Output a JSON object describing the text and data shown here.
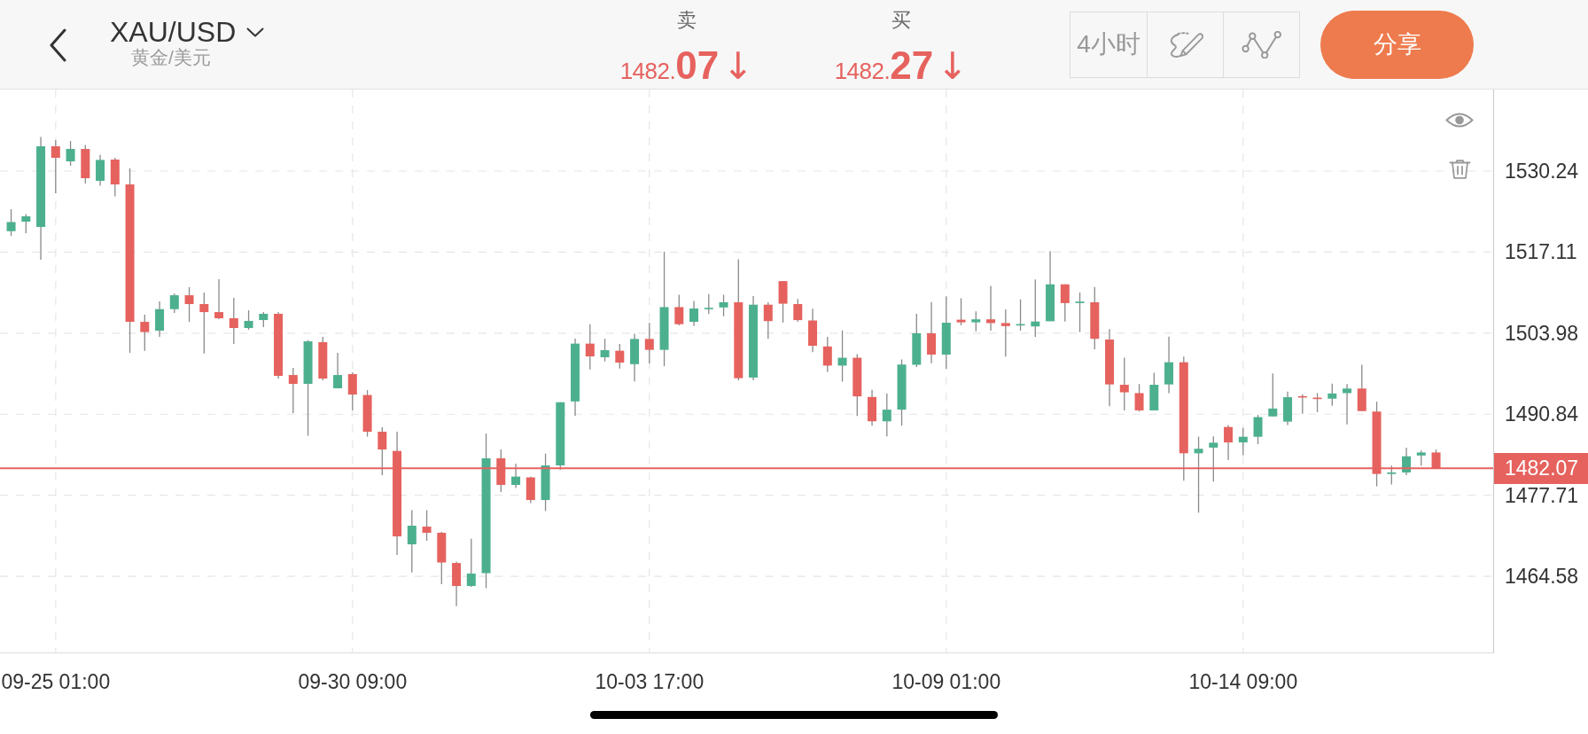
{
  "top_bar": {
    "symbol": "XAU/USD",
    "symbol_name": "黄金/美元",
    "quotes": [
      {
        "label": "卖",
        "price_integer": "1482.",
        "price_decimals": "07",
        "arrow": "↓"
      },
      {
        "label": "买",
        "price_integer": "1482.",
        "price_decimals": "27",
        "arrow": "↓"
      }
    ],
    "timeframe": "4小时",
    "share_button": "分享"
  },
  "chart": {
    "chart_data": {
      "type": "candlestick",
      "categories": [
        null,
        null,
        null,
        "09-25 01:00",
        null,
        null,
        null,
        null,
        null,
        null,
        null,
        null,
        null,
        null,
        null,
        null,
        null,
        null,
        null,
        null,
        null,
        null,
        null,
        "09-30 09:00",
        null,
        null,
        null,
        null,
        null,
        null,
        null,
        null,
        null,
        null,
        null,
        null,
        null,
        null,
        null,
        null,
        null,
        null,
        null,
        "10-03 17:00",
        null,
        null,
        null,
        null,
        null,
        null,
        null,
        null,
        null,
        null,
        null,
        null,
        null,
        null,
        null,
        null,
        null,
        null,
        null,
        "10-09 01:00",
        null,
        null,
        null,
        null,
        null,
        null,
        null,
        null,
        null,
        null,
        null,
        null,
        null,
        null,
        null,
        null,
        null,
        null,
        null,
        "10-14 09:00",
        null,
        null,
        null,
        null,
        null,
        null,
        null,
        null,
        null,
        null,
        null,
        null,
        null
      ],
      "ohlc": [
        [
          1520.5,
          1524.06,
          1519.75,
          1521.98
        ],
        [
          1522.05,
          1523.26,
          1520.18,
          1522.91
        ],
        [
          1521.19,
          1535.77,
          1515.87,
          1534.26
        ],
        [
          1534.26,
          1535.27,
          1526.65,
          1532.39
        ],
        [
          1531.82,
          1535.12,
          1531.1,
          1533.83
        ],
        [
          1533.83,
          1534.48,
          1528.23,
          1529.09
        ],
        [
          1528.66,
          1532.88,
          1527.87,
          1532.05
        ],
        [
          1532.11,
          1532.39,
          1526.14,
          1528.08
        ],
        [
          1528.08,
          1530.67,
          1500.79,
          1505.81
        ],
        [
          1505.81,
          1506.96,
          1501.13,
          1504.15
        ],
        [
          1504.38,
          1509.12,
          1503.37,
          1507.87
        ],
        [
          1507.87,
          1510.41,
          1507.25,
          1510.12
        ],
        [
          1510.12,
          1511.42,
          1505.81,
          1508.69
        ],
        [
          1508.69,
          1510.56,
          1500.68,
          1507.39
        ],
        [
          1507.39,
          1512.71,
          1506.25,
          1506.39
        ],
        [
          1506.39,
          1509.69,
          1502.22,
          1504.81
        ],
        [
          1504.81,
          1507.68,
          1504.52,
          1505.96
        ],
        [
          1506.1,
          1507.39,
          1504.95,
          1507.11
        ],
        [
          1507.11,
          1507.39,
          1496.62,
          1497.05
        ],
        [
          1497.19,
          1498.34,
          1491.02,
          1495.76
        ],
        [
          1495.76,
          1502.85,
          1487.34,
          1502.65
        ],
        [
          1502.51,
          1503.37,
          1496.33,
          1496.62
        ],
        [
          1495.04,
          1500.79,
          1495.04,
          1497.19
        ],
        [
          1497.34,
          1497.62,
          1491.5,
          1494.03
        ],
        [
          1493.95,
          1494.75,
          1487.21,
          1488.0
        ],
        [
          1488.0,
          1488.72,
          1480.96,
          1485.12
        ],
        [
          1484.89,
          1488.0,
          1468.03,
          1471.04
        ],
        [
          1469.75,
          1475.28,
          1465.21,
          1472.77
        ],
        [
          1472.62,
          1475.28,
          1470.33,
          1471.62
        ],
        [
          1471.62,
          1471.76,
          1463.28,
          1466.81
        ],
        [
          1466.73,
          1466.94,
          1459.75,
          1463.0
        ],
        [
          1463.0,
          1470.66,
          1462.85,
          1465.01
        ],
        [
          1465.08,
          1487.71,
          1462.64,
          1483.69
        ],
        [
          1483.69,
          1485.12,
          1478.23,
          1479.38
        ],
        [
          1479.38,
          1482.83,
          1478.87,
          1480.73
        ],
        [
          1480.6,
          1480.73,
          1476.43,
          1476.93
        ],
        [
          1476.93,
          1484.45,
          1475.15,
          1482.54
        ],
        [
          1482.54,
          1492.78,
          1481.82,
          1492.78
        ],
        [
          1492.91,
          1503.08,
          1490.58,
          1502.28
        ],
        [
          1502.28,
          1505.43,
          1498.11,
          1500.21
        ],
        [
          1500.07,
          1503.08,
          1499.39,
          1501.22
        ],
        [
          1501.13,
          1502.22,
          1498.24,
          1499.2
        ],
        [
          1498.95,
          1503.87,
          1496.17,
          1503.04
        ],
        [
          1503.04,
          1505.64,
          1499.06,
          1501.27
        ],
        [
          1501.27,
          1517.18,
          1498.62,
          1508.2
        ],
        [
          1508.2,
          1510.2,
          1505.25,
          1505.43
        ],
        [
          1505.81,
          1509.19,
          1505.15,
          1507.97
        ],
        [
          1507.97,
          1510.3,
          1507.09,
          1508.08
        ],
        [
          1508.14,
          1510.2,
          1506.7,
          1508.98
        ],
        [
          1508.98,
          1515.96,
          1496.33,
          1496.68
        ],
        [
          1496.78,
          1509.98,
          1496.33,
          1508.59
        ],
        [
          1508.59,
          1508.98,
          1503.04,
          1505.93
        ],
        [
          1512.41,
          1512.41,
          1505.7,
          1508.75
        ],
        [
          1508.69,
          1509.52,
          1505.81,
          1506.09
        ],
        [
          1506.03,
          1507.93,
          1500.89,
          1501.93
        ],
        [
          1501.82,
          1503.37,
          1497.67,
          1498.72
        ],
        [
          1498.72,
          1504.43,
          1496.12,
          1499.99
        ],
        [
          1499.99,
          1500.56,
          1490.57,
          1493.73
        ],
        [
          1493.63,
          1494.79,
          1488.98,
          1489.69
        ],
        [
          1489.69,
          1494.23,
          1487.25,
          1491.58
        ],
        [
          1491.58,
          1499.72,
          1488.98,
          1498.89
        ],
        [
          1498.85,
          1507.11,
          1498.49,
          1503.96
        ],
        [
          1503.96,
          1509.03,
          1499.09,
          1500.5
        ],
        [
          1500.5,
          1509.94,
          1498.17,
          1505.67
        ],
        [
          1506.16,
          1509.64,
          1505.24,
          1505.73
        ],
        [
          1505.73,
          1507.5,
          1504.26,
          1506.22
        ],
        [
          1506.22,
          1511.65,
          1504.39,
          1505.61
        ],
        [
          1505.61,
          1507.83,
          1500.18,
          1505.12
        ],
        [
          1505.31,
          1509.45,
          1504.39,
          1505.45
        ],
        [
          1505.07,
          1512.68,
          1503.36,
          1505.86
        ],
        [
          1505.91,
          1517.27,
          1505.91,
          1511.89
        ],
        [
          1511.89,
          1511.89,
          1505.86,
          1508.85
        ],
        [
          1508.85,
          1510.56,
          1504.15,
          1509.09
        ],
        [
          1508.98,
          1511.46,
          1501.35,
          1503.06
        ],
        [
          1502.94,
          1504.64,
          1492.14,
          1495.67
        ],
        [
          1495.61,
          1499.99,
          1491.46,
          1494.39
        ],
        [
          1494.26,
          1495.73,
          1491.27,
          1491.46
        ],
        [
          1491.46,
          1497.57,
          1491.46,
          1495.61
        ],
        [
          1495.67,
          1503.42,
          1494.26,
          1499.26
        ],
        [
          1499.26,
          1500.18,
          1480.05,
          1484.51
        ],
        [
          1484.51,
          1487.19,
          1474.88,
          1485.24
        ],
        [
          1485.43,
          1487.25,
          1479.94,
          1486.22
        ],
        [
          1488.77,
          1489.09,
          1483.41,
          1486.27
        ],
        [
          1486.27,
          1488.6,
          1484.21,
          1487.19
        ],
        [
          1487.19,
          1490.73,
          1485.97,
          1490.37
        ],
        [
          1490.48,
          1497.44,
          1490.48,
          1491.76
        ],
        [
          1489.64,
          1494.51,
          1489.09,
          1493.6
        ],
        [
          1493.77,
          1494.09,
          1490.91,
          1493.6
        ],
        [
          1493.53,
          1494.26,
          1491.16,
          1493.29
        ],
        [
          1493.36,
          1495.8,
          1492.19,
          1494.2
        ],
        [
          1494.26,
          1495.73,
          1489.2,
          1495.0
        ],
        [
          1495.0,
          1498.85,
          1491.35,
          1491.35
        ],
        [
          1491.27,
          1492.87,
          1479.15,
          1481.16
        ],
        [
          1481.16,
          1482.5,
          1479.45,
          1481.4
        ],
        [
          1481.4,
          1485.43,
          1480.97,
          1484.02
        ],
        [
          1484.15,
          1484.94,
          1482.5,
          1484.64
        ],
        [
          1484.64,
          1485.12,
          1481.95,
          1482.07
        ]
      ],
      "ylim": [
        1452.23,
        1543.46
      ],
      "yticks": [
        1530.24,
        1517.11,
        1503.98,
        1490.84,
        1477.71,
        1464.58
      ],
      "grid": true,
      "ref_lines": [
        {
          "axis": "y",
          "value": 1482.07,
          "label": "1482.07"
        }
      ]
    }
  }
}
